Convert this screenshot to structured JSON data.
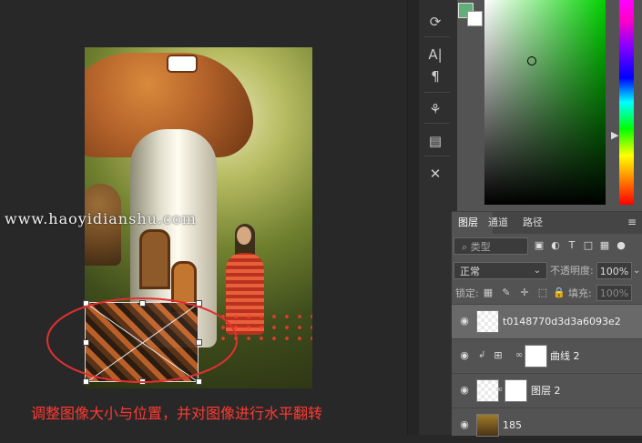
{
  "canvas": {
    "watermark": "www.haoyidianshu.com",
    "caption": "调整图像大小与位置，并对图像进行水平翻转"
  },
  "toolbar": {
    "icons": [
      "history-brush-icon",
      "character-icon",
      "paragraph-icon",
      "clone-source-icon",
      "layer-comps-icon",
      "tools-icon"
    ],
    "character_label": "A|",
    "paragraph_label": "¶"
  },
  "color_picker": {
    "foreground_color": "#62ad79",
    "background_color": "#ffffff"
  },
  "layers_panel": {
    "tabs": [
      "图层",
      "通道",
      "路径"
    ],
    "menu_icon": "≡",
    "search_placeholder": "类型",
    "filter_icons": [
      "image-filter-icon",
      "adjustment-filter-icon",
      "type-filter-icon",
      "shape-filter-icon",
      "smart-object-filter-icon",
      "filter-toggle-icon"
    ],
    "blend_mode": "正常",
    "opacity_label": "不透明度:",
    "opacity_value": "100%",
    "lock_label": "锁定:",
    "fill_label": "填充:",
    "fill_value": "100%",
    "layers": [
      {
        "name": "t0148770d3d3a6093e2",
        "selected": true
      },
      {
        "name": "曲线 2",
        "selected": false
      },
      {
        "name": "图层 2",
        "selected": false
      },
      {
        "name": "185",
        "selected": false
      }
    ]
  }
}
